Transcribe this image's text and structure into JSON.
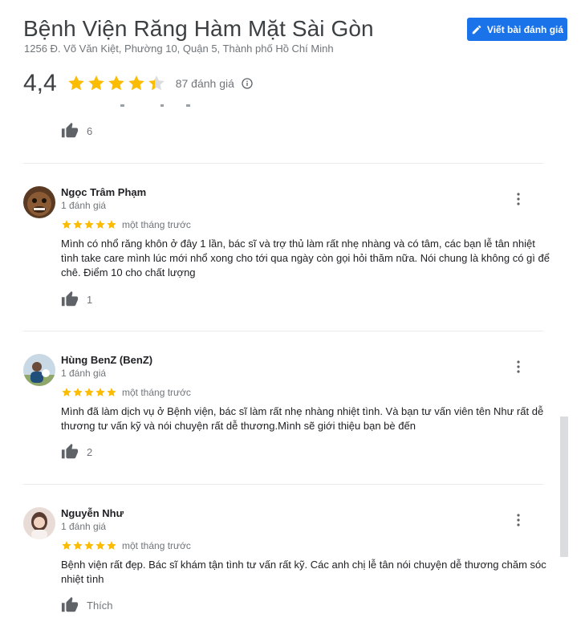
{
  "header": {
    "title": "Bệnh Viện Răng Hàm Mặt Sài Gòn",
    "address": "1256 Đ. Võ Văn Kiệt, Phường 10, Quận 5, Thành phố Hồ Chí Minh",
    "write_review_label": "Viết bài đánh giá",
    "write_icon": "pencil-icon",
    "rating": "4,4",
    "rating_value": 4.4,
    "review_count": "87 đánh giá",
    "info_icon": "info-icon"
  },
  "colors": {
    "accent": "#1a73e8",
    "star": "#fbbc04",
    "star_empty": "#dadce0",
    "muted": "#70757a"
  },
  "previous_review": {
    "likes": "6"
  },
  "reviews": [
    {
      "name": "Ngọc Trâm Phạm",
      "meta": "1 đánh giá",
      "stars": 5,
      "time": "một tháng trước",
      "text": "Mình có nhổ răng khôn ở đây 1 lần, bác sĩ và trợ thủ làm rất nhẹ nhàng và có tâm, các bạn lễ tân nhiệt tình take care mình lúc mới nhổ xong cho tới qua ngày còn gọi hỏi thăm nữa. Nói chung là không có gì để chê. Điểm 10 cho chất lượng",
      "likes": "1"
    },
    {
      "name": "Hùng BenZ (BenZ)",
      "meta": "1 đánh giá",
      "stars": 5,
      "time": "một tháng trước",
      "text": "Mình đã làm dịch vụ ở Bệnh viện, bác sĩ làm rất nhẹ nhàng nhiệt tình. Và bạn tư vấn viên tên Như rất dễ thương tư vấn kỹ và nói chuyện rất dễ thương.Mình sẽ giới thiệu bạn bè đến",
      "likes": "2"
    },
    {
      "name": "Nguyễn Như",
      "meta": "1 đánh giá",
      "stars": 5,
      "time": "một tháng trước",
      "text": "Bệnh viện rất đẹp. Bác sĩ khám tận tình tư vấn rất kỹ. Các anh chị lễ tân nói chuyện dễ thương chăm sóc nhiệt tình",
      "likes": "Thích"
    }
  ]
}
